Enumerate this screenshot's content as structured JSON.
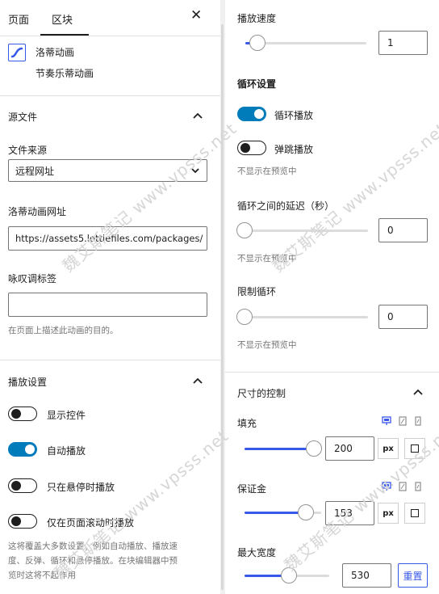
{
  "tabs": {
    "page": "页面",
    "block": "区块"
  },
  "block_card": {
    "title": "洛蒂动画",
    "description": "节奏乐蒂动画"
  },
  "source_section": {
    "title": "源文件",
    "file_source_label": "文件来源",
    "file_source_value": "远程网址",
    "url_label": "洛蒂动画网址",
    "url_value": "https://assets5.lottiefiles.com/packages/",
    "aria_label": "咏叹调标签",
    "aria_value": "",
    "aria_help": "在页面上描述此动画的目的。"
  },
  "playback_section": {
    "title": "播放设置",
    "toggles": [
      {
        "label": "显示控件",
        "on": false
      },
      {
        "label": "自动播放",
        "on": true
      },
      {
        "label": "只在悬停时播放",
        "on": false
      },
      {
        "label": "仅在页面滚动时播放",
        "on": false
      }
    ],
    "help_lines": [
      "这将覆盖大多数设置，例如自动播放、播放速",
      "度、反弹、循环和悬停播放。在块编辑器中预",
      "览时这将不起作用"
    ]
  },
  "speed": {
    "label": "播放速度",
    "value": "1",
    "slider_fraction": 0.05
  },
  "loop_section": {
    "title": "循环设置",
    "loop_toggle": {
      "label": "循环播放",
      "on": true
    },
    "bounce_toggle": {
      "label": "弹跳播放",
      "on": false
    },
    "bounce_help": "不显示在预览中",
    "delay": {
      "label": "循环之间的延迟（秒）",
      "value": "0",
      "slider_fraction": 0,
      "help": "不显示在预览中"
    },
    "limit": {
      "label": "限制循环",
      "value": "0",
      "slider_fraction": 0,
      "help": "不显示在预览中"
    }
  },
  "size_section": {
    "title": "尺寸的控制",
    "padding": {
      "label": "填充",
      "value": "200",
      "unit": "px",
      "slider_fraction": 1
    },
    "margin": {
      "label": "保证金",
      "value": "153",
      "unit": "px",
      "slider_fraction": 0.77
    },
    "max_width": {
      "label": "最大宽度",
      "value": "530",
      "reset": "重置",
      "slider_fraction": 0.52
    }
  },
  "watermark": "魏艾斯笔记 www.vpsss.net",
  "colors": {
    "accent": "#3858e9",
    "toggle_on": "#007cba",
    "text": "#1e1e1e",
    "help": "#757575"
  }
}
